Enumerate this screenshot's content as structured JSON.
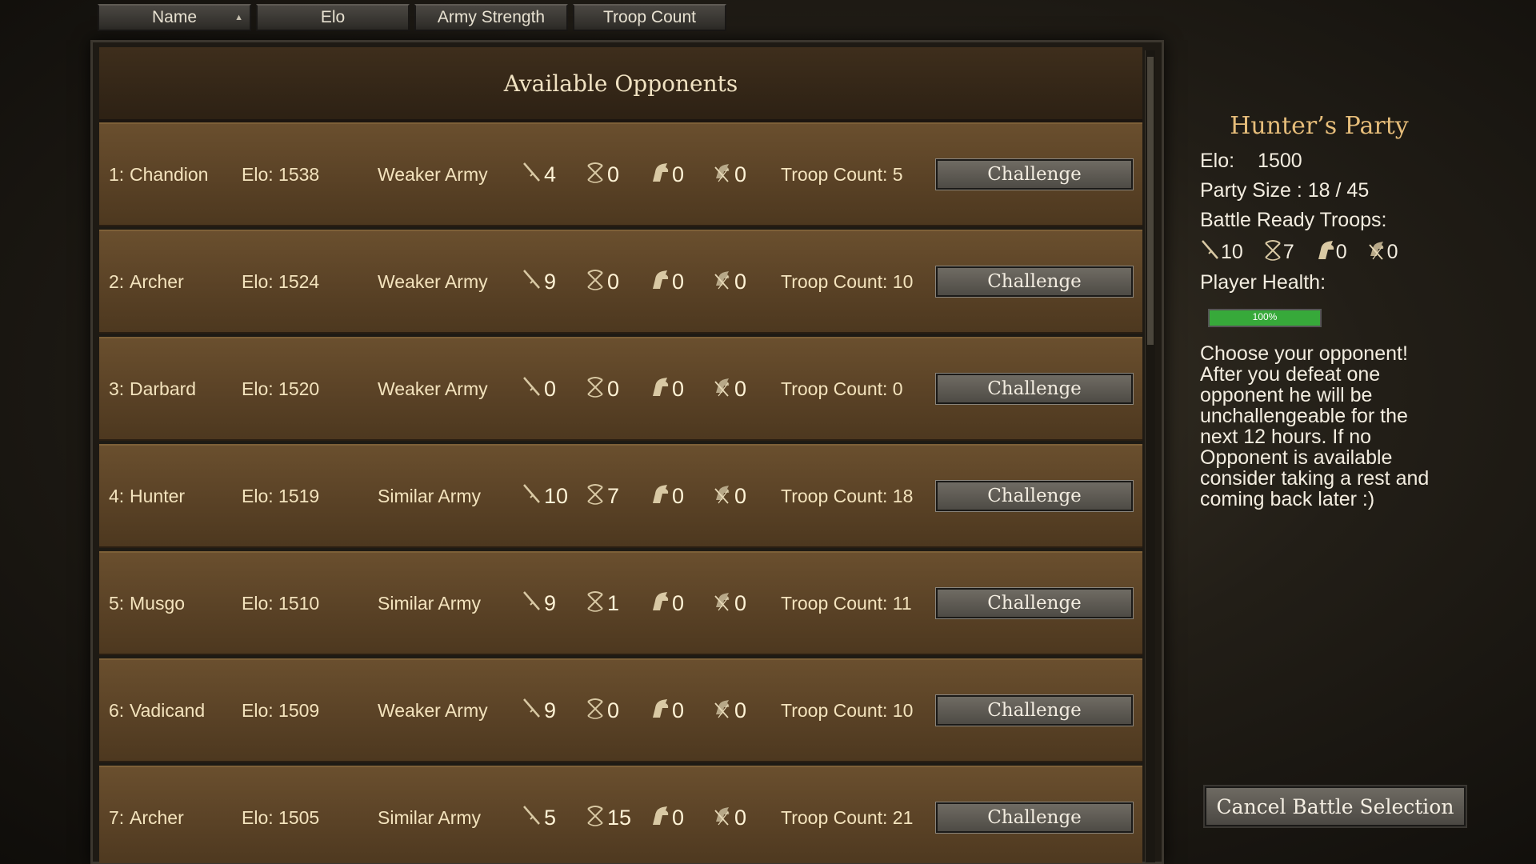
{
  "sort_tabs": [
    {
      "label": "Name",
      "sorted": true
    },
    {
      "label": "Elo"
    },
    {
      "label": "Army Strength"
    },
    {
      "label": "Troop Count"
    }
  ],
  "list": {
    "title": "Available Opponents",
    "challenge_label": "Challenge",
    "rows": [
      {
        "index": "1:",
        "name": "Chandion",
        "elo": "Elo: 1538",
        "strength": "Weaker Army",
        "infantry": "4",
        "archers": "0",
        "cavalry": "0",
        "horse_archers": "0",
        "troop_count": "Troop Count: 5"
      },
      {
        "index": "2:",
        "name": "Archer",
        "elo": "Elo: 1524",
        "strength": "Weaker Army",
        "infantry": "9",
        "archers": "0",
        "cavalry": "0",
        "horse_archers": "0",
        "troop_count": "Troop Count: 10"
      },
      {
        "index": "3:",
        "name": "Darbard",
        "elo": "Elo: 1520",
        "strength": "Weaker Army",
        "infantry": "0",
        "archers": "0",
        "cavalry": "0",
        "horse_archers": "0",
        "troop_count": "Troop Count: 0"
      },
      {
        "index": "4:",
        "name": "Hunter",
        "elo": "Elo: 1519",
        "strength": "Similar Army",
        "infantry": "10",
        "archers": "7",
        "cavalry": "0",
        "horse_archers": "0",
        "troop_count": "Troop Count: 18"
      },
      {
        "index": "5:",
        "name": "Musgo",
        "elo": "Elo: 1510",
        "strength": "Similar Army",
        "infantry": "9",
        "archers": "1",
        "cavalry": "0",
        "horse_archers": "0",
        "troop_count": "Troop Count: 11"
      },
      {
        "index": "6:",
        "name": "Vadicand",
        "elo": "Elo: 1509",
        "strength": "Weaker Army",
        "infantry": "9",
        "archers": "0",
        "cavalry": "0",
        "horse_archers": "0",
        "troop_count": "Troop Count: 10"
      },
      {
        "index": "7:",
        "name": "Archer",
        "elo": "Elo: 1505",
        "strength": "Similar Army",
        "infantry": "5",
        "archers": "15",
        "cavalry": "0",
        "horse_archers": "0",
        "troop_count": "Troop Count: 21"
      }
    ]
  },
  "party": {
    "title": "Hunter’s Party",
    "elo_label": "Elo:",
    "elo_value": "1500",
    "party_size": "Party Size : 18 / 45",
    "battle_ready_label": "Battle Ready Troops:",
    "troops": {
      "infantry": "10",
      "archers": "7",
      "cavalry": "0",
      "horse_archers": "0"
    },
    "health_label": "Player Health:",
    "health_percent_text": "100%",
    "health_fraction": 1.0,
    "info_text": "Choose your opponent! After you defeat one opponent he will be unchallengeable for the next 12 hours. If no Opponent is available consider taking a rest and coming back later :)"
  },
  "cancel_button": "Cancel Battle Selection",
  "icons": {
    "infantry": "sword-icon",
    "archers": "bow-icon",
    "cavalry": "horse-head-icon",
    "horse_archers": "horse-archer-icon"
  },
  "colors": {
    "party_title": "#e6bd7a",
    "health": "#37a93a",
    "row_bg": "#5a4226"
  }
}
